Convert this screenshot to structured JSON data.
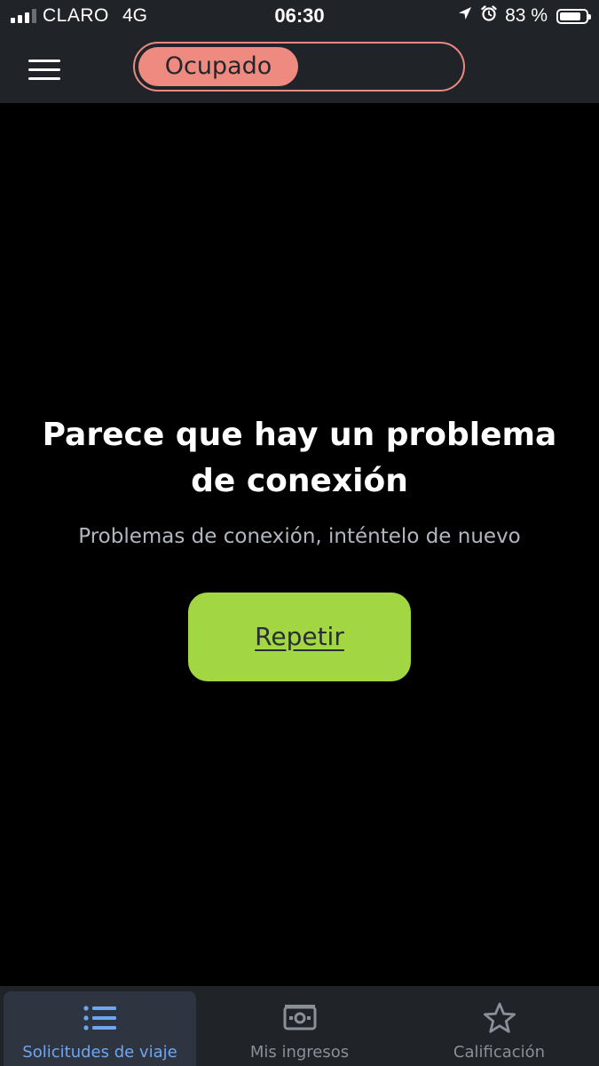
{
  "status_bar": {
    "carrier": "CLARO",
    "network": "4G",
    "time": "06:30",
    "battery_percent_label": "83 %",
    "battery_level": 0.83,
    "signal_bars_filled": 3,
    "signal_bars_total": 4
  },
  "app_bar": {
    "status_toggle_label": "Ocupado",
    "status_color": "#ef8a80"
  },
  "error": {
    "title": "Parece que hay un problema de conexión",
    "subtitle": "Problemas de conexión, inténtelo de nuevo",
    "retry_label": "Repetir",
    "retry_color": "#a2d642"
  },
  "bottom_nav": {
    "active_color": "#6fa6f2",
    "items": [
      {
        "label": "Solicitudes de viaje",
        "icon": "list-icon",
        "active": true
      },
      {
        "label": "Mis ingresos",
        "icon": "cash-icon",
        "active": false
      },
      {
        "label": "Calificación",
        "icon": "star-icon",
        "active": false
      }
    ]
  }
}
